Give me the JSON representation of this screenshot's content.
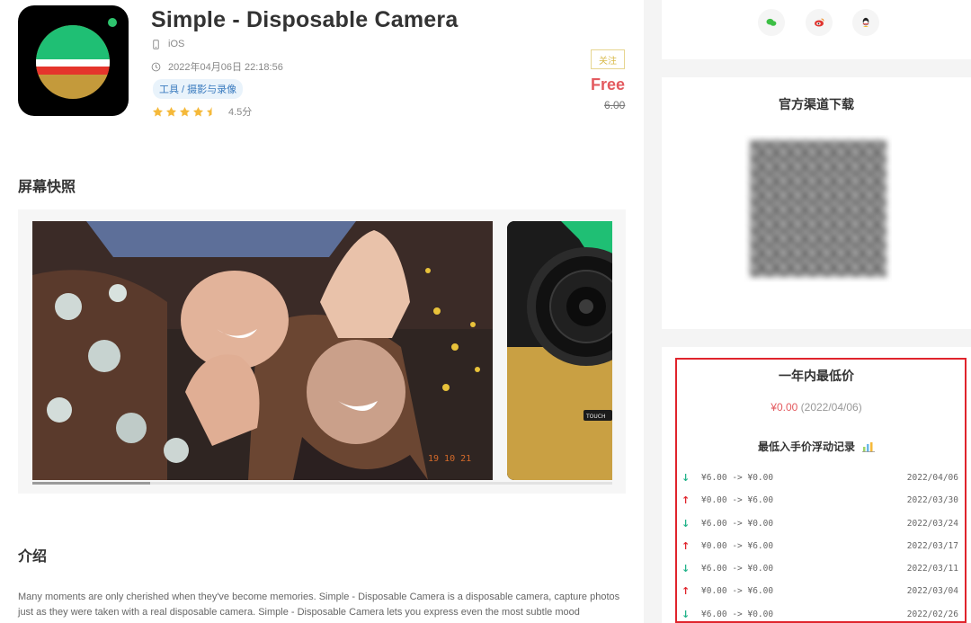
{
  "app": {
    "title": "Simple - Disposable Camera",
    "platform": "iOS",
    "date": "2022年04月06日 22:18:56",
    "category": "工具 / 摄影与录像",
    "rating_value": 4.5,
    "rating_text": "4.5分",
    "follow_label": "关注",
    "price_now": "Free",
    "price_old": "6.00",
    "icon_colors": {
      "green": "#1fbf74",
      "white": "#ffffff",
      "red": "#e5352c",
      "gold": "#c49a3b"
    }
  },
  "screenshots": {
    "title": "屏幕快照",
    "stamp": "19 10 21",
    "touch_label": "TOUCH"
  },
  "intro": {
    "title": "介绍",
    "text": "Many moments are only cherished when they've become memories. Simple - Disposable Camera is a disposable camera, capture photos just as they were taken with a real disposable camera.  Simple - Disposable Camera lets you express even the most subtle mood"
  },
  "share": {
    "buttons": [
      {
        "name": "wechat-icon",
        "color": "#3dbf45"
      },
      {
        "name": "weibo-icon",
        "color": "#e0342f"
      },
      {
        "name": "qq-icon",
        "color": "#222222"
      }
    ]
  },
  "download": {
    "title": "官方渠道下载"
  },
  "lowest": {
    "title": "一年内最低价",
    "price": "¥0.00",
    "date": "(2022/04/06)",
    "history_title": "最低入手价浮动记录",
    "history": [
      {
        "dir": "down",
        "arrow": "↓",
        "change": "¥6.00 -> ¥0.00",
        "date": "2022/04/06"
      },
      {
        "dir": "up",
        "arrow": "↑",
        "change": "¥0.00 -> ¥6.00",
        "date": "2022/03/30"
      },
      {
        "dir": "down",
        "arrow": "↓",
        "change": "¥6.00 -> ¥0.00",
        "date": "2022/03/24"
      },
      {
        "dir": "up",
        "arrow": "↑",
        "change": "¥0.00 -> ¥6.00",
        "date": "2022/03/17"
      },
      {
        "dir": "down",
        "arrow": "↓",
        "change": "¥6.00 -> ¥0.00",
        "date": "2022/03/11"
      },
      {
        "dir": "up",
        "arrow": "↑",
        "change": "¥0.00 -> ¥6.00",
        "date": "2022/03/04"
      },
      {
        "dir": "down",
        "arrow": "↓",
        "change": "¥6.00 -> ¥0.00",
        "date": "2022/02/26"
      }
    ]
  }
}
